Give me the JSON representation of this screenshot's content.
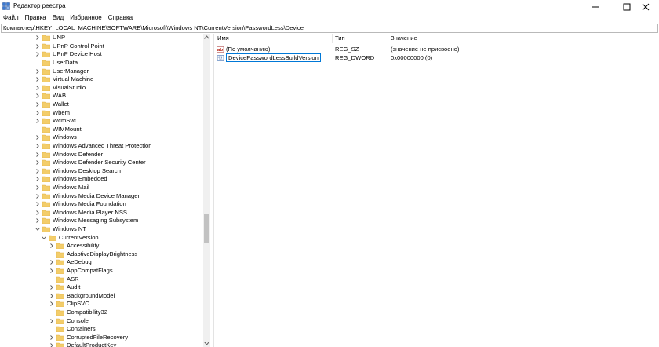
{
  "window": {
    "title": "Редактор реестра",
    "icon": "registry-editor-icon"
  },
  "menu": [
    "Файл",
    "Правка",
    "Вид",
    "Избранное",
    "Справка"
  ],
  "address": "Компьютер\\HKEY_LOCAL_MACHINE\\SOFTWARE\\Microsoft\\Windows NT\\CurrentVersion\\PasswordLess\\Device",
  "tree": [
    {
      "label": "UNP",
      "level": 0,
      "expander": "collapsed"
    },
    {
      "label": "UPnP Control Point",
      "level": 0,
      "expander": "collapsed"
    },
    {
      "label": "UPnP Device Host",
      "level": 0,
      "expander": "collapsed"
    },
    {
      "label": "UserData",
      "level": 0,
      "expander": "none"
    },
    {
      "label": "UserManager",
      "level": 0,
      "expander": "collapsed"
    },
    {
      "label": "Virtual Machine",
      "level": 0,
      "expander": "collapsed"
    },
    {
      "label": "VisualStudio",
      "level": 0,
      "expander": "collapsed"
    },
    {
      "label": "WAB",
      "level": 0,
      "expander": "collapsed"
    },
    {
      "label": "Wallet",
      "level": 0,
      "expander": "collapsed"
    },
    {
      "label": "Wbem",
      "level": 0,
      "expander": "collapsed"
    },
    {
      "label": "WcmSvc",
      "level": 0,
      "expander": "collapsed"
    },
    {
      "label": "WIMMount",
      "level": 0,
      "expander": "none"
    },
    {
      "label": "Windows",
      "level": 0,
      "expander": "collapsed"
    },
    {
      "label": "Windows Advanced Threat Protection",
      "level": 0,
      "expander": "collapsed"
    },
    {
      "label": "Windows Defender",
      "level": 0,
      "expander": "collapsed"
    },
    {
      "label": "Windows Defender Security Center",
      "level": 0,
      "expander": "collapsed"
    },
    {
      "label": "Windows Desktop Search",
      "level": 0,
      "expander": "collapsed"
    },
    {
      "label": "Windows Embedded",
      "level": 0,
      "expander": "collapsed"
    },
    {
      "label": "Windows Mail",
      "level": 0,
      "expander": "collapsed"
    },
    {
      "label": "Windows Media Device Manager",
      "level": 0,
      "expander": "collapsed"
    },
    {
      "label": "Windows Media Foundation",
      "level": 0,
      "expander": "collapsed"
    },
    {
      "label": "Windows Media Player NSS",
      "level": 0,
      "expander": "collapsed"
    },
    {
      "label": "Windows Messaging Subsystem",
      "level": 0,
      "expander": "collapsed"
    },
    {
      "label": "Windows NT",
      "level": 0,
      "expander": "expanded"
    },
    {
      "label": "CurrentVersion",
      "level": 1,
      "expander": "expanded"
    },
    {
      "label": "Accessibility",
      "level": 2,
      "expander": "collapsed"
    },
    {
      "label": "AdaptiveDisplayBrightness",
      "level": 2,
      "expander": "none"
    },
    {
      "label": "AeDebug",
      "level": 2,
      "expander": "collapsed"
    },
    {
      "label": "AppCompatFlags",
      "level": 2,
      "expander": "collapsed"
    },
    {
      "label": "ASR",
      "level": 2,
      "expander": "none"
    },
    {
      "label": "Audit",
      "level": 2,
      "expander": "collapsed"
    },
    {
      "label": "BackgroundModel",
      "level": 2,
      "expander": "collapsed"
    },
    {
      "label": "ClipSVC",
      "level": 2,
      "expander": "collapsed"
    },
    {
      "label": "Compatibility32",
      "level": 2,
      "expander": "none"
    },
    {
      "label": "Console",
      "level": 2,
      "expander": "collapsed"
    },
    {
      "label": "Containers",
      "level": 2,
      "expander": "none"
    },
    {
      "label": "CorruptedFileRecovery",
      "level": 2,
      "expander": "collapsed"
    },
    {
      "label": "DefaultProductKey",
      "level": 2,
      "expander": "collapsed"
    }
  ],
  "list": {
    "columns": [
      "Имя",
      "Тип",
      "Значение"
    ],
    "rows": [
      {
        "name": "(По умолчанию)",
        "type": "REG_SZ",
        "value": "(значение не присвоено)",
        "icon": "string-value-icon",
        "editing": false
      },
      {
        "name": "DevicePasswordLessBuildVersion",
        "type": "REG_DWORD",
        "value": "0x00000000 (0)",
        "icon": "dword-value-icon",
        "editing": true
      }
    ]
  },
  "colors": {
    "folder": "#f3cd6a",
    "folder_dark": "#e2b14a",
    "accent": "#0078d7"
  }
}
